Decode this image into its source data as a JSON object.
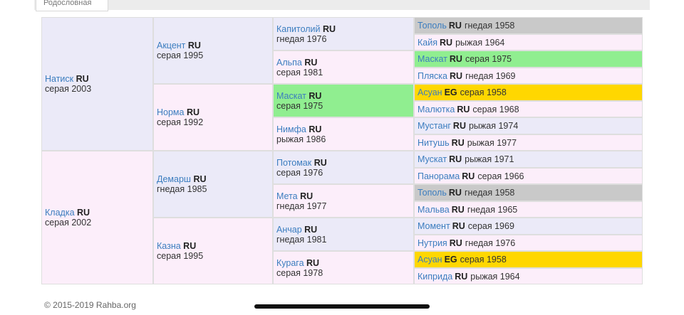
{
  "tab": {
    "label": "Родословная"
  },
  "pedigree": {
    "gen1": [
      {
        "name": "Натиск",
        "cc": "RU",
        "meta": "серая 2003"
      },
      {
        "name": "Кладка",
        "cc": "RU",
        "meta": "серая 2002"
      }
    ],
    "gen2": [
      {
        "name": "Акцент",
        "cc": "RU",
        "meta": "серая 1995"
      },
      {
        "name": "Норма",
        "cc": "RU",
        "meta": "серая 1992"
      },
      {
        "name": "Демарш",
        "cc": "RU",
        "meta": "гнедая 1985"
      },
      {
        "name": "Казна",
        "cc": "RU",
        "meta": "серая 1995"
      }
    ],
    "gen3": [
      {
        "name": "Капитолий",
        "cc": "RU",
        "meta": "гнедая 1976"
      },
      {
        "name": "Альпа",
        "cc": "RU",
        "meta": "серая 1981"
      },
      {
        "name": "Маскат",
        "cc": "RU",
        "meta": "серая 1975"
      },
      {
        "name": "Нимфа",
        "cc": "RU",
        "meta": "рыжая 1986"
      },
      {
        "name": "Потомак",
        "cc": "RU",
        "meta": "серая 1976"
      },
      {
        "name": "Мета",
        "cc": "RU",
        "meta": "гнедая 1977"
      },
      {
        "name": "Анчар",
        "cc": "RU",
        "meta": "гнедая 1981"
      },
      {
        "name": "Курага",
        "cc": "RU",
        "meta": "серая 1978"
      }
    ],
    "gen4": [
      {
        "name": "Тополь",
        "cc": "RU",
        "meta": "гнедая 1958"
      },
      {
        "name": "Кайя",
        "cc": "RU",
        "meta": "рыжая 1964"
      },
      {
        "name": "Маскат",
        "cc": "RU",
        "meta": "серая 1975"
      },
      {
        "name": "Пляска",
        "cc": "RU",
        "meta": "гнедая 1969"
      },
      {
        "name": "Асуан",
        "cc": "EG",
        "meta": "серая 1958"
      },
      {
        "name": "Малютка",
        "cc": "RU",
        "meta": "серая 1968"
      },
      {
        "name": "Мустанг",
        "cc": "RU",
        "meta": "рыжая 1974"
      },
      {
        "name": "Нитушь",
        "cc": "RU",
        "meta": "рыжая 1977"
      },
      {
        "name": "Мускат",
        "cc": "RU",
        "meta": "рыжая 1971"
      },
      {
        "name": "Панорама",
        "cc": "RU",
        "meta": "серая 1966"
      },
      {
        "name": "Тополь",
        "cc": "RU",
        "meta": "гнедая 1958"
      },
      {
        "name": "Мальва",
        "cc": "RU",
        "meta": "гнедая 1965"
      },
      {
        "name": "Момент",
        "cc": "RU",
        "meta": "серая 1969"
      },
      {
        "name": "Нутрия",
        "cc": "RU",
        "meta": "гнедая 1976"
      },
      {
        "name": "Асуан",
        "cc": "EG",
        "meta": "серая 1958"
      },
      {
        "name": "Киприда",
        "cc": "RU",
        "meta": "рыжая 1964"
      }
    ]
  },
  "colors": {
    "sire_bg": "#ebeaf8",
    "dam_bg": "#fceefa",
    "repeat_grey": "#c9c9c9",
    "repeat_green": "#90ee90",
    "repeat_gold": "#ffd700",
    "link": "#3b7dbf"
  },
  "footer": {
    "copyright": "© 2015-2019 Rahba.org"
  }
}
